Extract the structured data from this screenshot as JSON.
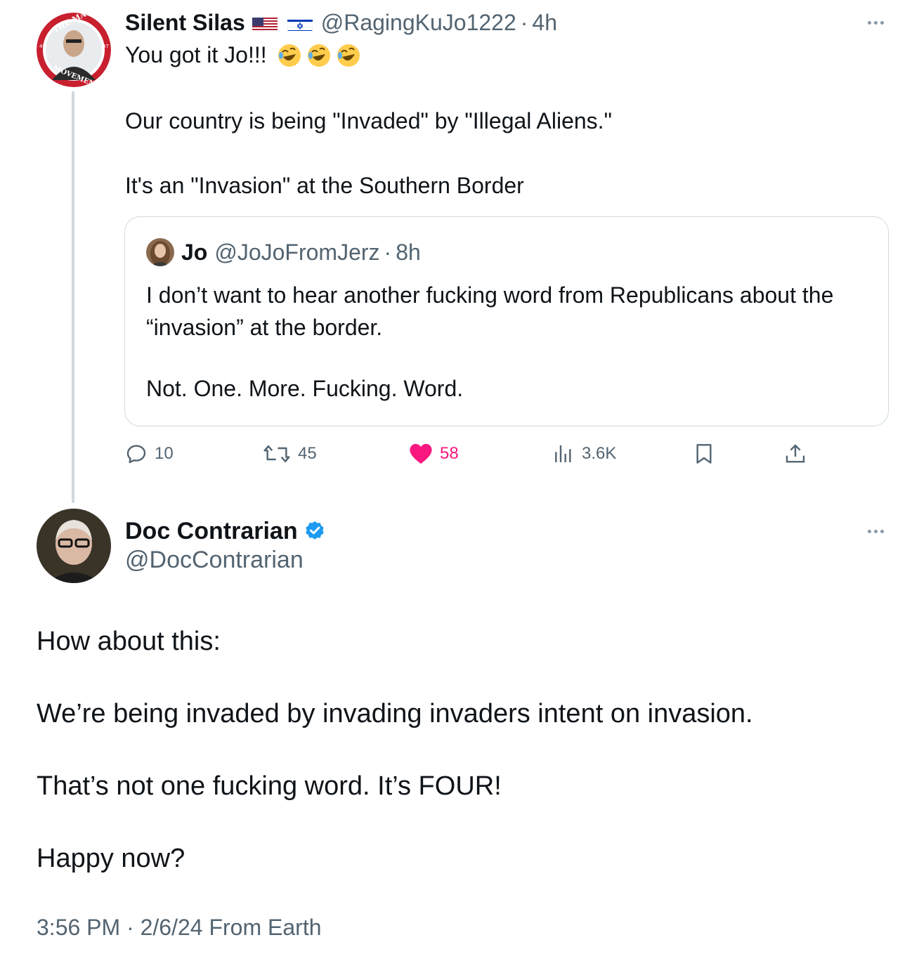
{
  "parent_tweet": {
    "author_name": "Silent Silas",
    "flags": [
      "us-flag",
      "israel-flag"
    ],
    "handle": "@RagingKuJo1222",
    "separator": "·",
    "time": "4h",
    "text_line1": "You got it Jo!!!",
    "emojis": [
      "rofl-emoji",
      "rofl-emoji",
      "rofl-emoji"
    ],
    "text_line2": "Our country is being \"Invaded\" by \"Illegal Aliens.\"",
    "text_line3": "It's an \"Invasion\" at the Southern Border",
    "avatar_badge_top": "THE MAGA",
    "avatar_badge_bottom": "MOVEMENT",
    "avatar_badge_left": "45",
    "avatar_badge_right": "47",
    "quoted": {
      "author_name": "Jo",
      "handle": "@JoJoFromJerz",
      "separator": "·",
      "time": "8h",
      "text_para1": "I don’t want to hear another fucking word from Republicans about the “invasion” at the border.",
      "text_para2": "Not. One. More. Fucking. Word."
    },
    "actions": {
      "replies": "10",
      "retweets": "45",
      "likes": "58",
      "views": "3.6K"
    }
  },
  "main_tweet": {
    "author_name": "Doc Contrarian",
    "verified": true,
    "handle": "@DocContrarian",
    "paragraphs": [
      "How about this:",
      "We’re being invaded by invading invaders intent on invasion.",
      "That’s not one fucking word. It’s FOUR!",
      "Happy now?"
    ],
    "meta": "3:56 PM · 2/6/24 From Earth"
  },
  "colors": {
    "text": "#0f1419",
    "secondary": "#536471",
    "like": "#f91880",
    "verified": "#1d9bf0",
    "border": "#cfd9de"
  }
}
